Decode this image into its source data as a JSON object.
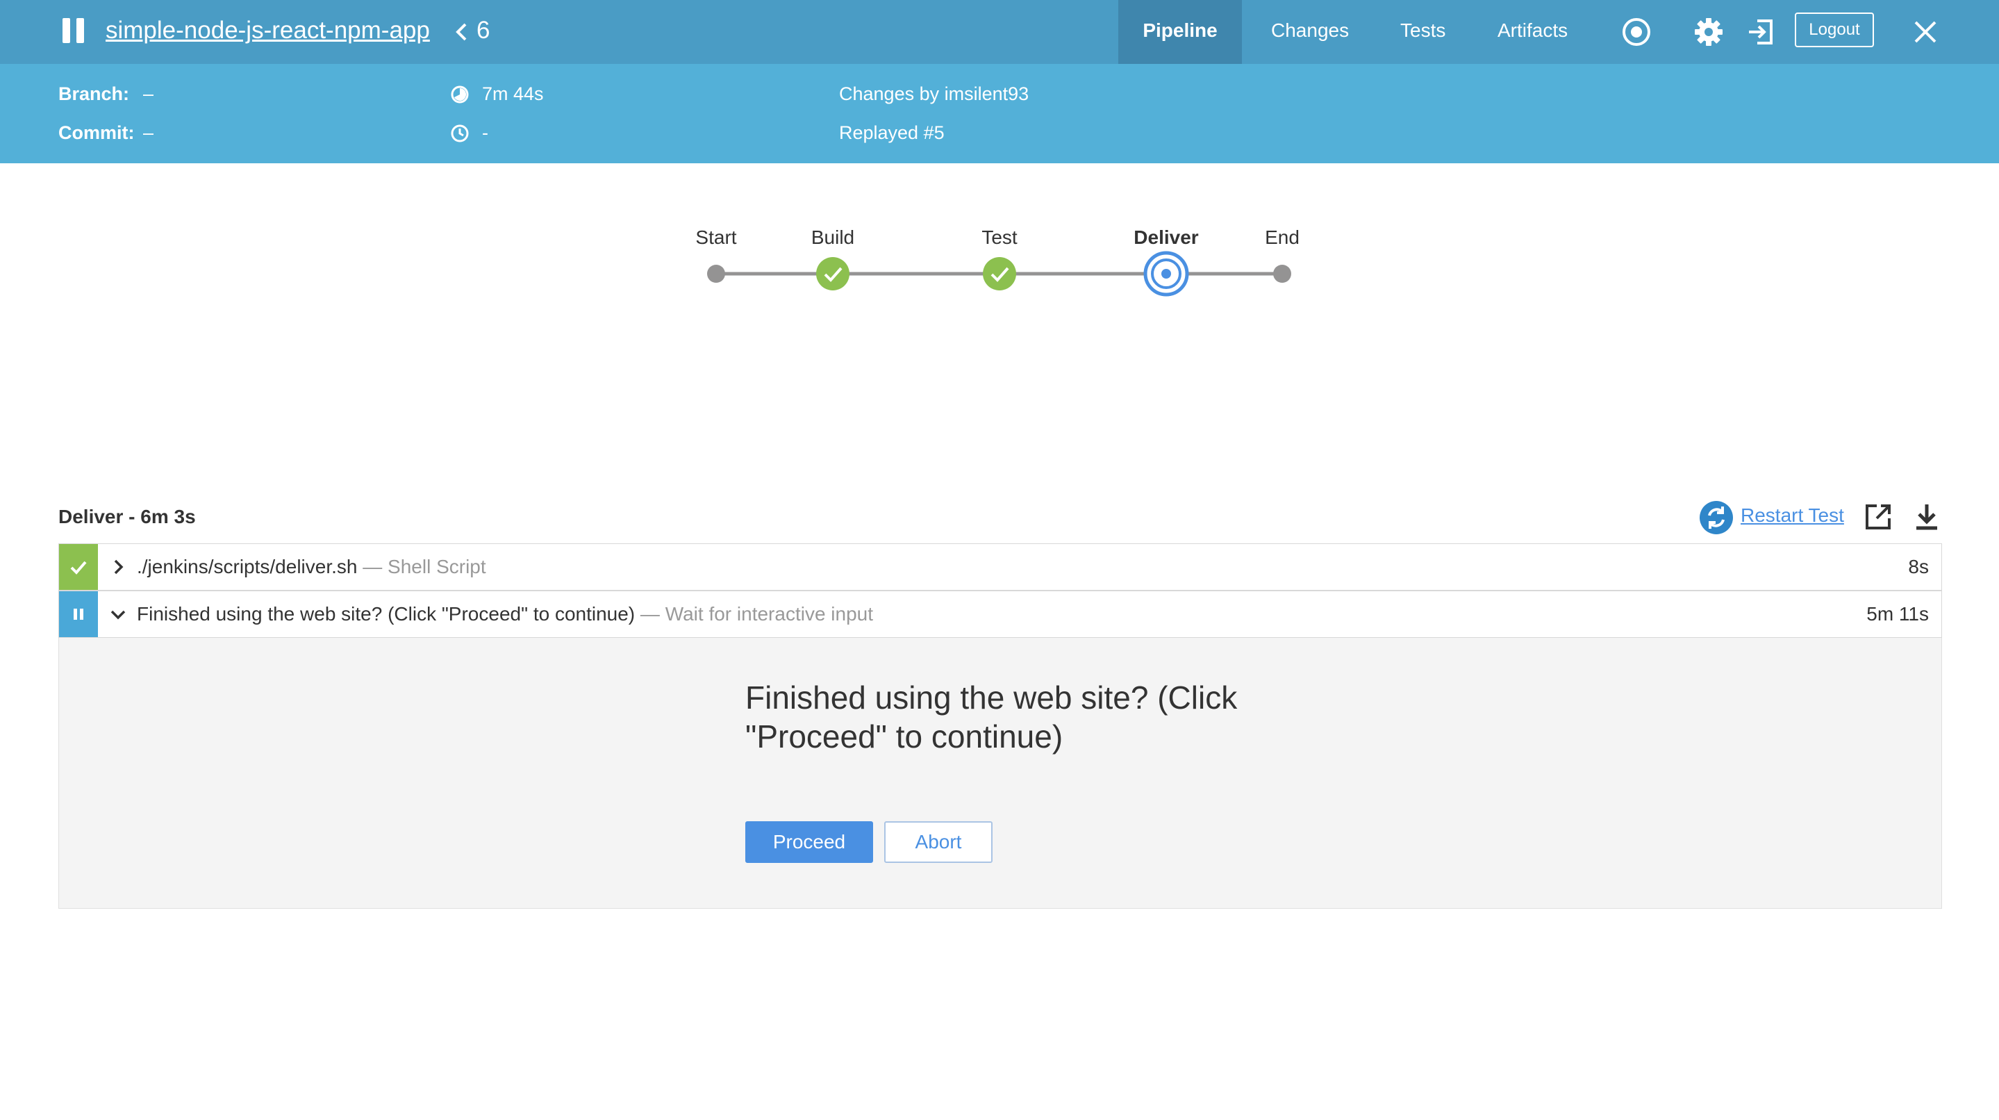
{
  "header": {
    "app_name": "simple-node-js-react-npm-app",
    "run_number": "6",
    "tabs": [
      {
        "label": "Pipeline",
        "active": true
      },
      {
        "label": "Changes",
        "active": false
      },
      {
        "label": "Tests",
        "active": false
      },
      {
        "label": "Artifacts",
        "active": false
      }
    ],
    "logout_label": "Logout",
    "icons": [
      "pause-icon",
      "back-chevron-icon",
      "stop-icon",
      "gear-icon",
      "sign-out-icon",
      "close-icon"
    ],
    "colors": {
      "header_bg": "#4a9cc5",
      "subbar_bg": "#53b0d8",
      "active_tab_bg": "#3f86ad"
    }
  },
  "summary": {
    "branch_label": "Branch:",
    "branch_value": "–",
    "commit_label": "Commit:",
    "commit_value": "–",
    "duration": "7m 44s",
    "started": "-",
    "changes": "Changes by imsilent93",
    "replayed": "Replayed #5"
  },
  "pipeline": {
    "stages": [
      {
        "name": "Start",
        "status": "none"
      },
      {
        "name": "Build",
        "status": "success"
      },
      {
        "name": "Test",
        "status": "success"
      },
      {
        "name": "Deliver",
        "status": "running"
      },
      {
        "name": "End",
        "status": "none"
      }
    ],
    "colors": {
      "success": "#8cc04f",
      "running": "#4a90e2",
      "idle": "#949393"
    }
  },
  "detail": {
    "title": "Deliver - 6m 3s",
    "restart_label": "Restart Test",
    "steps": [
      {
        "title": "./jenkins/scripts/deliver.sh",
        "desc": "— Shell Script",
        "duration": "8s",
        "status": "success"
      },
      {
        "title": "Finished using the web site? (Click \"Proceed\" to continue)",
        "desc": "— Wait for interactive input",
        "duration": "5m 11s",
        "status": "paused"
      }
    ],
    "input": {
      "message": "Finished using the web site? (Click \"Proceed\" to continue)",
      "proceed_label": "Proceed",
      "abort_label": "Abort"
    }
  }
}
